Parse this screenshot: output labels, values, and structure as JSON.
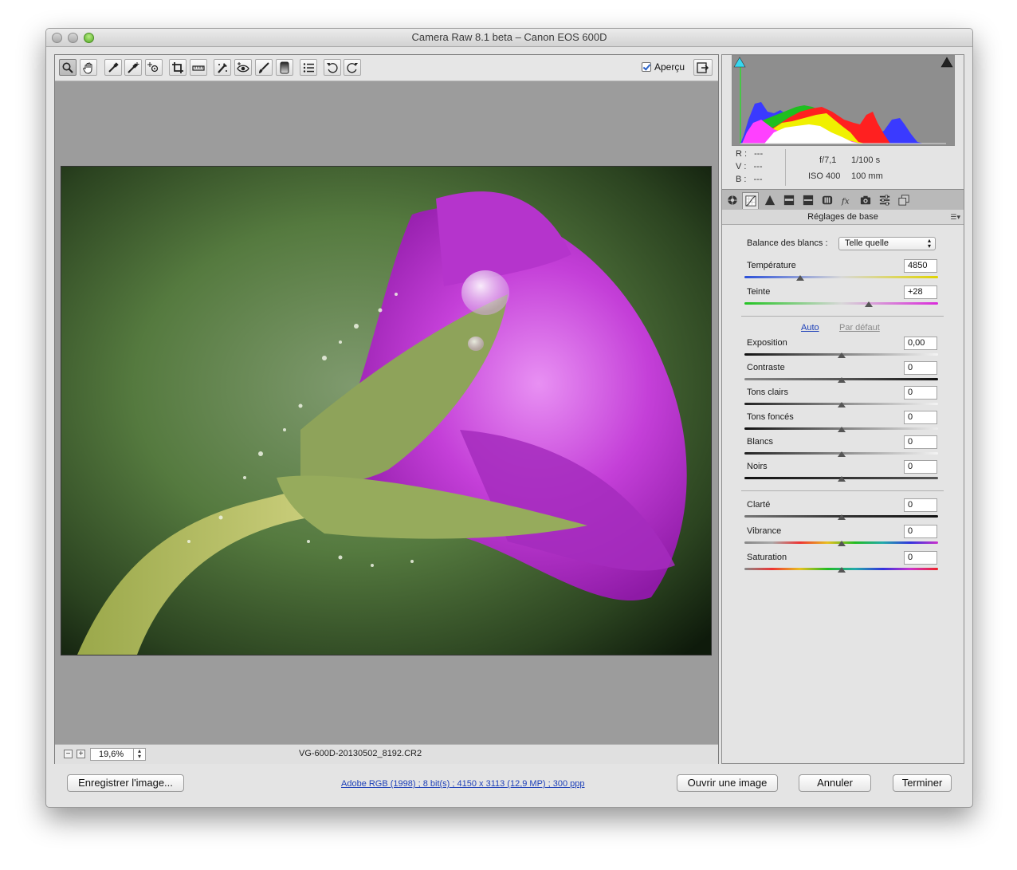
{
  "window": {
    "title": "Camera Raw 8.1 beta  –  Canon EOS 600D"
  },
  "toolbar": {
    "tools": [
      "zoom-tool-icon",
      "hand-tool-icon",
      "white-balance-tool-icon",
      "color-sampler-tool-icon",
      "targeted-adjustment-tool-icon",
      "crop-tool-icon",
      "straighten-tool-icon",
      "spot-removal-tool-icon",
      "red-eye-icon",
      "adjustment-brush-icon",
      "graduated-filter-icon",
      "preferences-icon",
      "rotate-left-icon",
      "rotate-right-icon"
    ],
    "preview_label": "Aperçu",
    "preview_checked": true
  },
  "status": {
    "zoom": "19,6%",
    "filename": "VG-600D-20130502_8192.CR2"
  },
  "info": {
    "r_label": "R :",
    "r_value": "---",
    "v_label": "V :",
    "v_value": "---",
    "b_label": "B :",
    "b_value": "---",
    "aperture": "f/7,1",
    "shutter": "1/100 s",
    "iso": "ISO 400",
    "focal": "100 mm"
  },
  "panel": {
    "title": "Réglages de base",
    "wb_label": "Balance des blancs :",
    "wb_value": "Telle quelle",
    "auto": "Auto",
    "default": "Par défaut",
    "sliders": [
      {
        "label": "Température",
        "value": "4850",
        "pos": 0.29
      },
      {
        "label": "Teinte",
        "value": "+28",
        "pos": 0.64
      },
      {
        "label": "Exposition",
        "value": "0,00",
        "pos": 0.5
      },
      {
        "label": "Contraste",
        "value": "0",
        "pos": 0.5
      },
      {
        "label": "Tons clairs",
        "value": "0",
        "pos": 0.5
      },
      {
        "label": "Tons foncés",
        "value": "0",
        "pos": 0.5
      },
      {
        "label": "Blancs",
        "value": "0",
        "pos": 0.5
      },
      {
        "label": "Noirs",
        "value": "0",
        "pos": 0.5
      },
      {
        "label": "Clarté",
        "value": "0",
        "pos": 0.5
      },
      {
        "label": "Vibrance",
        "value": "0",
        "pos": 0.5
      },
      {
        "label": "Saturation",
        "value": "0",
        "pos": 0.5
      }
    ]
  },
  "bottom": {
    "save": "Enregistrer l'image...",
    "workflow": "Adobe RGB (1998) ; 8 bit(s) ; 4150 x 3113 (12,9 MP) ; 300 ppp",
    "open": "Ouvrir une image",
    "cancel": "Annuler",
    "done": "Terminer"
  }
}
